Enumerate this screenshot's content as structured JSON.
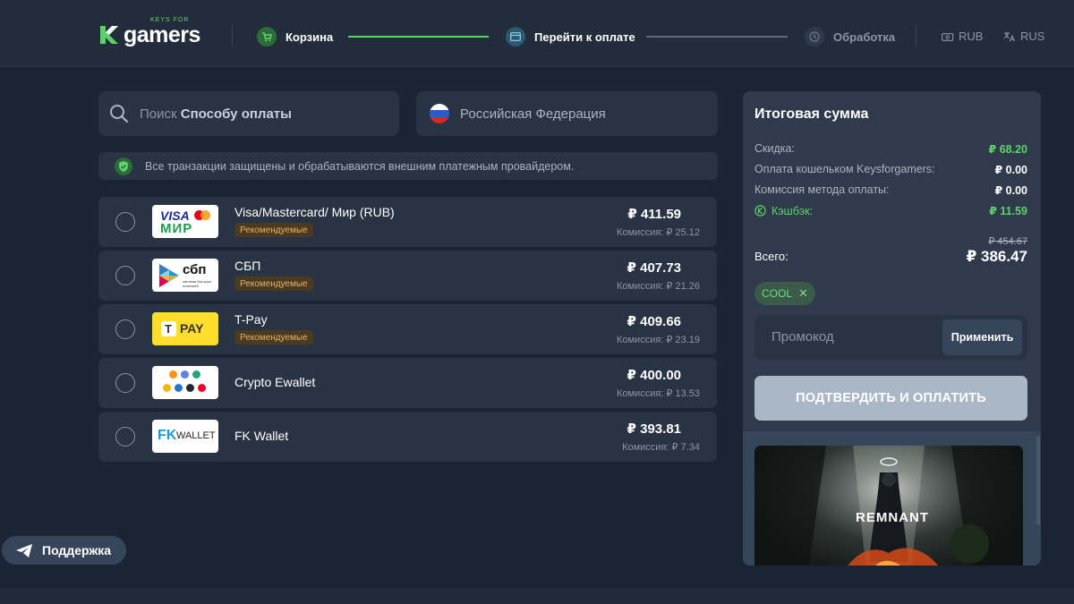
{
  "brand": {
    "small": "KEYS FOR",
    "big": "gamers",
    "accent": "#5fd16a"
  },
  "steps": [
    {
      "label": "Корзина",
      "icon": "cart-icon",
      "state": "done"
    },
    {
      "label": "Перейти к оплате",
      "icon": "card-icon",
      "state": "active"
    },
    {
      "label": "Обработка",
      "icon": "clock-icon",
      "state": "pending"
    }
  ],
  "header_options": {
    "currency": "RUB",
    "language": "RUS"
  },
  "search": {
    "placeholder_prefix": "Поиск",
    "placeholder_bold": "Способу оплаты"
  },
  "country": {
    "name": "Российская Федерация",
    "flag": "russia-flag"
  },
  "notice": "Все транзакции защищены и обрабатываются внешним платежным провайдером.",
  "payment_methods": [
    {
      "name": "Visa/Mastercard/ Мир (RUB)",
      "badge": "Рекомендуемые",
      "price": "₽ 411.59",
      "fee": "Комиссия: ₽ 25.12",
      "logo": "visa-mir-logo"
    },
    {
      "name": "СБП",
      "badge": "Рекомендуемые",
      "price": "₽ 407.73",
      "fee": "Комиссия: ₽ 21.26",
      "logo": "sbp-logo"
    },
    {
      "name": "T-Pay",
      "badge": "Рекомендуемые",
      "price": "₽ 409.66",
      "fee": "Комиссия: ₽ 23.19",
      "logo": "tpay-logo"
    },
    {
      "name": "Crypto Ewallet",
      "badge": "",
      "price": "₽ 400.00",
      "fee": "Комиссия: ₽ 13.53",
      "logo": "crypto-logo"
    },
    {
      "name": "FK Wallet",
      "badge": "",
      "price": "₽ 393.81",
      "fee": "Комиссия: ₽ 7.34",
      "logo": "fk-wallet-logo"
    }
  ],
  "logo_text": {
    "visa": "VISA",
    "mir": "МИР",
    "sbp": "сбп",
    "sbp_sub": "система быстрых платежей",
    "tpay": "PAY",
    "fk": "FK",
    "fk_wallet": "WALLET"
  },
  "summary": {
    "title": "Итоговая сумма",
    "rows": [
      {
        "label": "Скидка:",
        "value": "₽ 68.20",
        "green": true
      },
      {
        "label": "Оплата кошельком Keysforgamers:",
        "value": "₽ 0.00",
        "green": false
      },
      {
        "label": "Комиссия метода оплаты:",
        "value": "₽ 0.00",
        "green": false
      },
      {
        "label": "Кэшбэк:",
        "value": "₽ 11.59",
        "green": true
      }
    ],
    "total_label": "Всего:",
    "total_old": "₽ 454.67",
    "total_value": "₽ 386.47",
    "promo_code": "COOL",
    "promo_placeholder": "Промокод",
    "apply_label": "Применить",
    "confirm_label": "ПОДТВЕРДИТЬ И ОПЛАТИТЬ",
    "game_title": "REMNANT"
  },
  "support_label": "Поддержка"
}
